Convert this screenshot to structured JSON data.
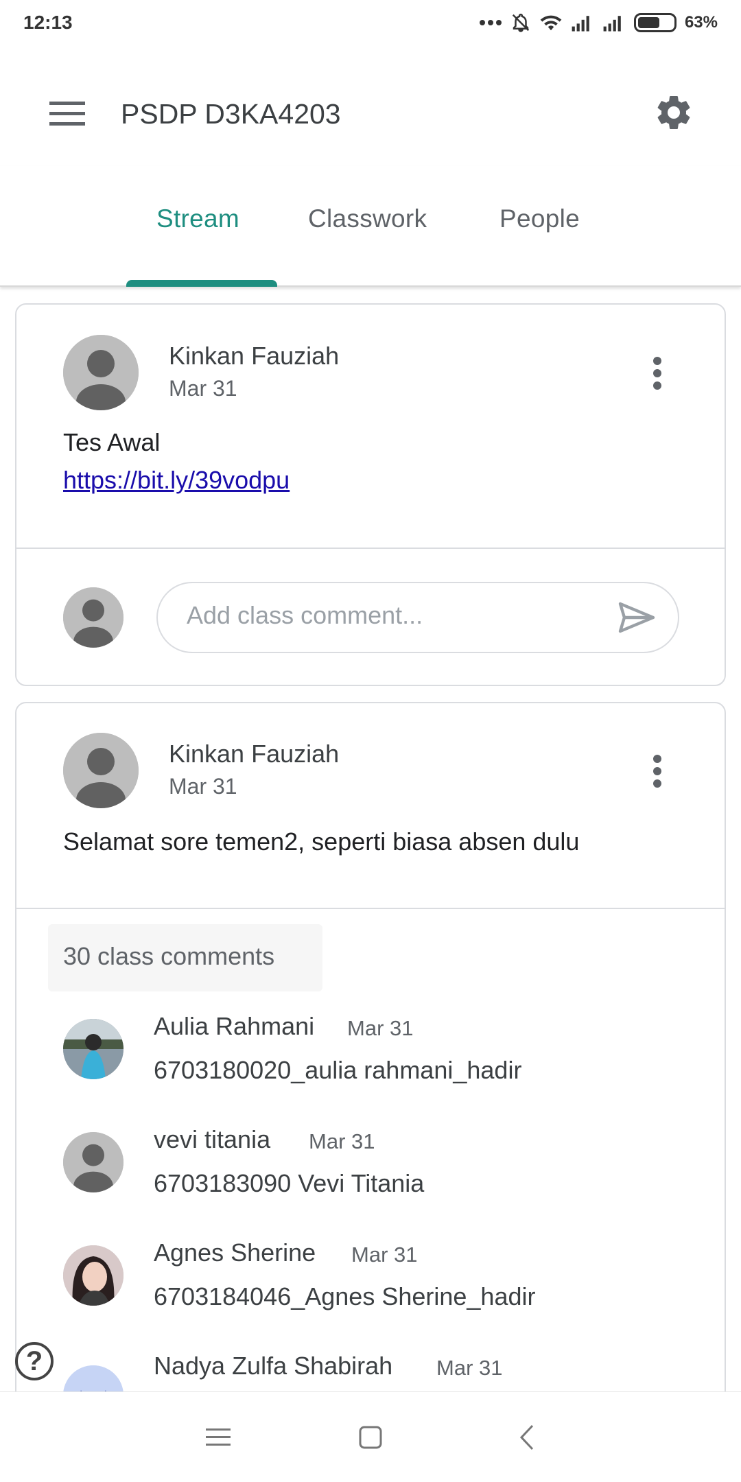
{
  "status_bar": {
    "time": "12:13",
    "battery": "63%"
  },
  "app_bar": {
    "title": "PSDP D3KA4203"
  },
  "tabs": [
    {
      "label": "Stream",
      "active": true
    },
    {
      "label": "Classwork",
      "active": false
    },
    {
      "label": "People",
      "active": false
    }
  ],
  "posts": [
    {
      "author": "Kinkan Fauziah",
      "date": "Mar 31",
      "text": "Tes Awal",
      "link": "https://bit.ly/39vodpu",
      "comment_placeholder": "Add class comment..."
    },
    {
      "author": "Kinkan Fauziah",
      "date": "Mar 31",
      "text": "Selamat sore temen2, seperti biasa absen dulu",
      "comments_count": "30 class comments",
      "comments": [
        {
          "author": "Aulia Rahmani",
          "date": "Mar 31",
          "text": "6703180020_aulia rahmani_hadir"
        },
        {
          "author": "vevi titania",
          "date": "Mar 31",
          "text": "6703183090 Vevi Titania"
        },
        {
          "author": "Agnes Sherine",
          "date": "Mar 31",
          "text": "6703184046_Agnes Sherine_hadir"
        },
        {
          "author": "Nadya Zulfa Shabirah",
          "date": "Mar 31",
          "text": ""
        }
      ]
    }
  ],
  "help_label": "?",
  "colors": {
    "accent": "#1e8e80",
    "link": "#1a0dab",
    "border": "#dadce0"
  }
}
